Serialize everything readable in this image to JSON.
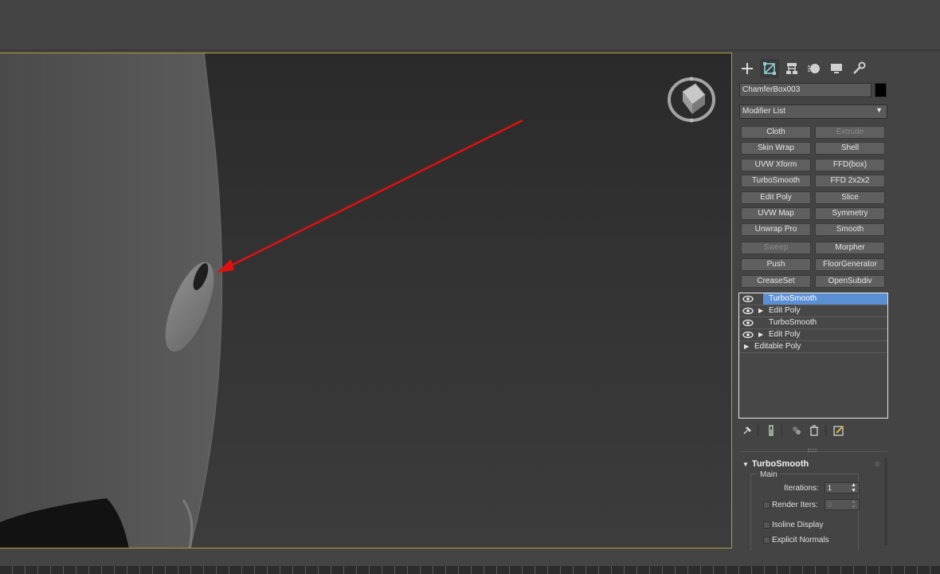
{
  "object": {
    "name": "ChamferBox003",
    "color": "#000000"
  },
  "modifier_list": {
    "label": "Modifier List",
    "arrow": "▼"
  },
  "modifier_buttons": [
    {
      "label": "Cloth",
      "enabled": true
    },
    {
      "label": "Extrude",
      "enabled": false
    },
    {
      "label": "Skin Wrap",
      "enabled": true
    },
    {
      "label": "Shell",
      "enabled": true
    },
    {
      "label": "UVW Xform",
      "enabled": true
    },
    {
      "label": "FFD(box)",
      "enabled": true
    },
    {
      "label": "TurboSmooth",
      "enabled": true
    },
    {
      "label": "FFD 2x2x2",
      "enabled": true
    },
    {
      "label": "Edit Poly",
      "enabled": true
    },
    {
      "label": "Slice",
      "enabled": true
    },
    {
      "label": "UVW Map",
      "enabled": true
    },
    {
      "label": "Symmetry",
      "enabled": true
    },
    {
      "label": "Unwrap Pro",
      "enabled": true
    },
    {
      "label": "Smooth",
      "enabled": true
    },
    {
      "label": "Sweep",
      "enabled": false
    },
    {
      "label": "Morpher",
      "enabled": true
    },
    {
      "label": "Push",
      "enabled": true
    },
    {
      "label": "FloorGenerator",
      "enabled": true
    },
    {
      "label": "CreaseSet",
      "enabled": true
    },
    {
      "label": "OpenSubdiv",
      "enabled": true
    }
  ],
  "modifier_stack": [
    {
      "label": "TurboSmooth",
      "selected": true,
      "expandable": false,
      "has_eye": true
    },
    {
      "label": "Edit Poly",
      "selected": false,
      "expandable": true,
      "has_eye": true
    },
    {
      "label": "TurboSmooth",
      "selected": false,
      "expandable": false,
      "has_eye": true
    },
    {
      "label": "Edit Poly",
      "selected": false,
      "expandable": true,
      "has_eye": true
    },
    {
      "label": "Editable Poly",
      "selected": false,
      "expandable": true,
      "has_eye": false
    }
  ],
  "rollout": {
    "title": "TurboSmooth",
    "group": "Main",
    "iterations_label": "Iterations:",
    "iterations_value": "1",
    "render_iters_label": "Render Iters:",
    "render_iters_value": "0",
    "isoline_label": "Isoline Display",
    "explicit_normals_label": "Explicit Normals"
  },
  "colors": {
    "viewport_border": "#b59a3c",
    "selection": "#5b8fd4",
    "annotation_arrow": "#e01010"
  },
  "icons": {
    "tabs": [
      "create-icon",
      "modify-icon",
      "hierarchy-icon",
      "motion-icon",
      "display-icon",
      "utilities-icon"
    ],
    "stack_tools": [
      "pin-stack-icon",
      "show-end-result-icon",
      "make-unique-icon",
      "remove-modifier-icon",
      "configure-modifier-sets-icon"
    ]
  }
}
